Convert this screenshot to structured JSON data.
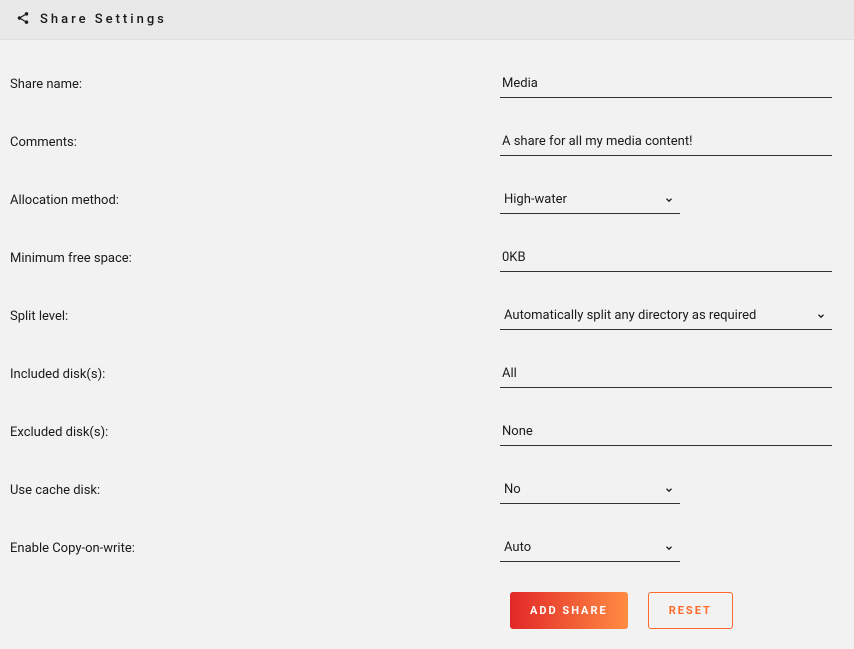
{
  "header": {
    "title": "Share Settings"
  },
  "fields": {
    "share_name": {
      "label": "Share name:",
      "value": "Media"
    },
    "comments": {
      "label": "Comments:",
      "value": "A share for all my media content!"
    },
    "allocation_method": {
      "label": "Allocation method:",
      "value": "High-water"
    },
    "minimum_free_space": {
      "label": "Minimum free space:",
      "value": "0KB"
    },
    "split_level": {
      "label": "Split level:",
      "value": "Automatically split any directory as required"
    },
    "included_disks": {
      "label": "Included disk(s):",
      "value": "All"
    },
    "excluded_disks": {
      "label": "Excluded disk(s):",
      "value": "None"
    },
    "use_cache_disk": {
      "label": "Use cache disk:",
      "value": "No"
    },
    "enable_cow": {
      "label": "Enable Copy-on-write:",
      "value": "Auto"
    }
  },
  "buttons": {
    "add_share": "ADD SHARE",
    "reset": "RESET"
  }
}
